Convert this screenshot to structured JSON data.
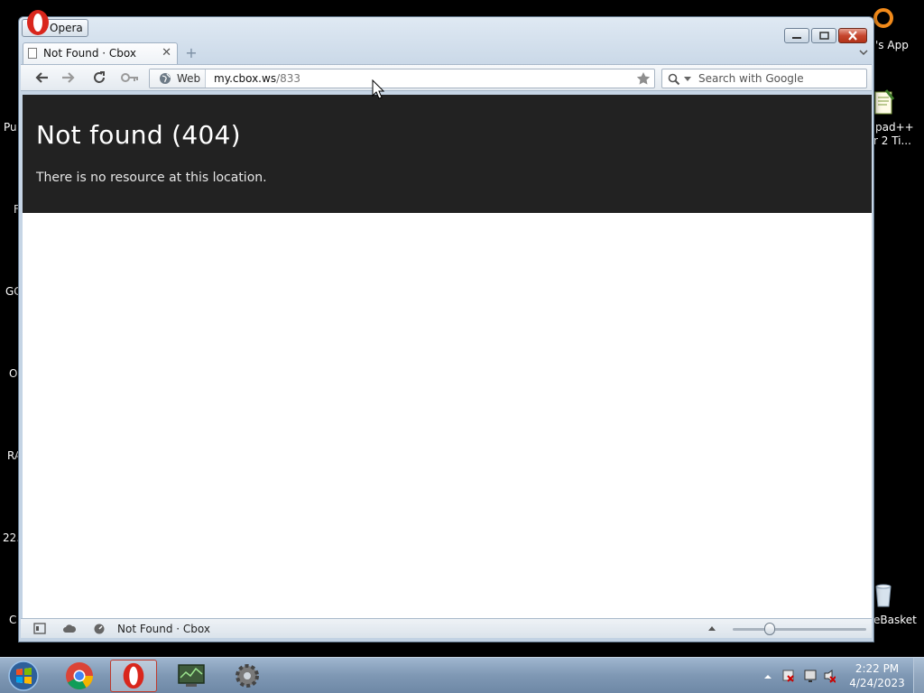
{
  "desktop": {
    "right_labels": [
      "'s App",
      "pad++",
      "r 2 Ti...",
      "eBasket"
    ],
    "left_labels": [
      "Pu",
      "F",
      "GC",
      "O",
      "RA",
      "22.",
      "C"
    ]
  },
  "window": {
    "menu_label": "Opera",
    "tab": {
      "title": "Not Found · Cbox"
    },
    "address": {
      "mode_label": "Web",
      "host": "my.cbox.ws",
      "path": "/833"
    },
    "search": {
      "placeholder": "Search with Google"
    },
    "status": {
      "title": "Not Found · Cbox"
    }
  },
  "page": {
    "heading": "Not found (404)",
    "message": "There is no resource at this location."
  },
  "taskbar": {
    "apps": [
      "chrome-icon",
      "opera-icon",
      "monitor-app-icon",
      "settings-gear-icon"
    ],
    "active_app": "opera-icon",
    "time": "2:22 PM",
    "date": "4/24/2023"
  },
  "colors": {
    "hero_bg": "#222222",
    "window_frame": "#c7d6e6",
    "taskbar": "#7f98b4"
  }
}
